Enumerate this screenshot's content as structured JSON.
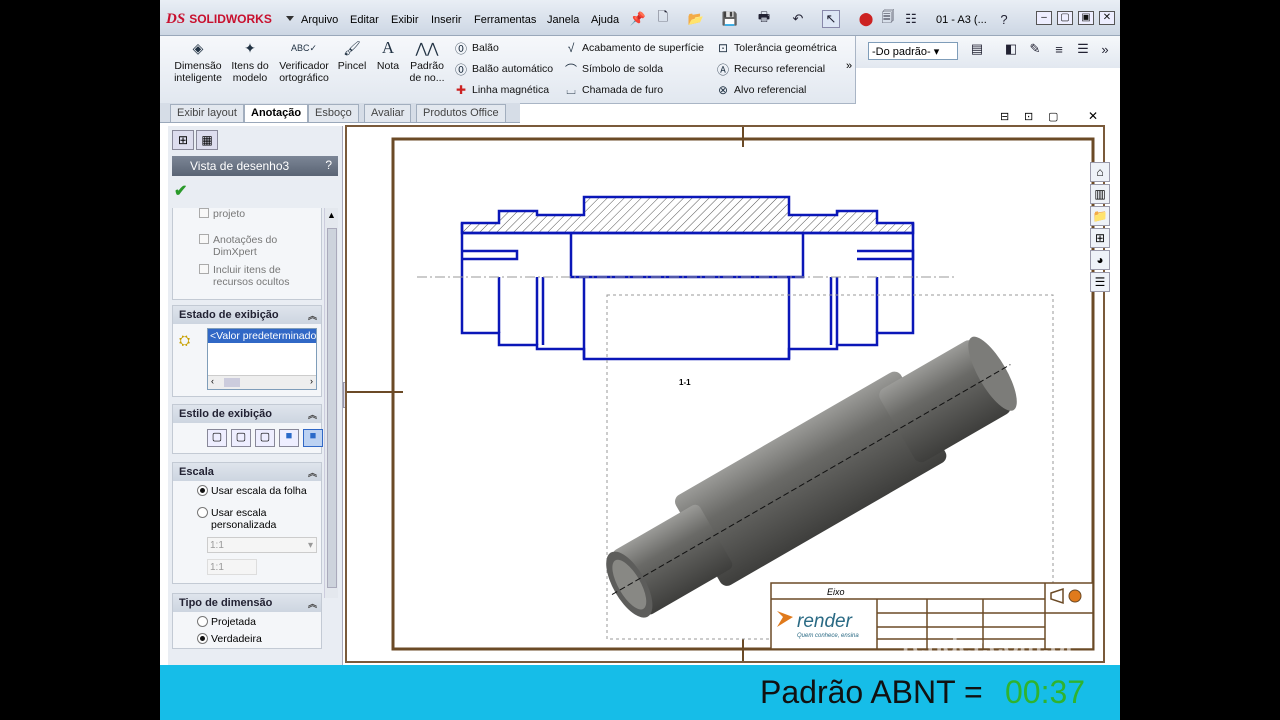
{
  "app": {
    "brand": "SOLIDWORKS",
    "brand_mark": "DS",
    "doc_title": "01 - A3 (..."
  },
  "menu": [
    "Arquivo",
    "Editar",
    "Exibir",
    "Inserir",
    "Ferramentas",
    "Janela",
    "Ajuda"
  ],
  "command_manager": {
    "big": [
      {
        "label": "Dimensão inteligente",
        "icon": "smart-dimension-icon"
      },
      {
        "label": "Itens do modelo",
        "icon": "model-items-icon"
      },
      {
        "label": "Verificador ortográfico",
        "icon": "spell-check-icon"
      },
      {
        "label": "Pincel",
        "icon": "format-painter-icon"
      },
      {
        "label": "Nota",
        "icon": "note-icon"
      },
      {
        "label": "Padrão de no...",
        "icon": "linear-pattern-icon"
      }
    ],
    "small_col1": [
      "Balão",
      "Balão automático",
      "Linha magnética"
    ],
    "small_col2": [
      "Acabamento de superfície",
      "Símbolo de solda",
      "Chamada de furo"
    ],
    "small_col3": [
      "Tolerância geométrica",
      "Recurso referencial",
      "Alvo referencial"
    ]
  },
  "standard_select": "-Do padrão-",
  "tabs": [
    "Exibir layout",
    "Anotação",
    "Esboço",
    "Avaliar",
    "Produtos Office"
  ],
  "active_tab": "Anotação",
  "property_manager": {
    "title": "Vista de desenho3",
    "help": "?",
    "import_options": [
      "projeto",
      "Anotações do DimXpert",
      "Incluir itens de recursos ocultos"
    ],
    "display_state": {
      "header": "Estado de exibição",
      "value": "<Valor predeterminado"
    },
    "display_style": {
      "header": "Estilo de exibição"
    },
    "scale": {
      "header": "Escala",
      "opt_sheet": "Usar escala da folha",
      "opt_custom": "Usar escala personalizada",
      "selected": "Usar escala da folha",
      "dropdown": "1:1",
      "field": "1:1"
    },
    "dimension_type": {
      "header": "Tipo de dimensão",
      "opt_projected": "Projetada",
      "opt_true": "Verdadeira",
      "selected": "Verdadeira"
    }
  },
  "drawing": {
    "section_label": "1-1",
    "titleblock": {
      "part": "Eixo",
      "company": "render",
      "slogan": "Quem conhece, ensina"
    }
  },
  "overlay": {
    "text": "Padrão ABNT =",
    "time": "00:37",
    "watermark": "render.com.br"
  }
}
